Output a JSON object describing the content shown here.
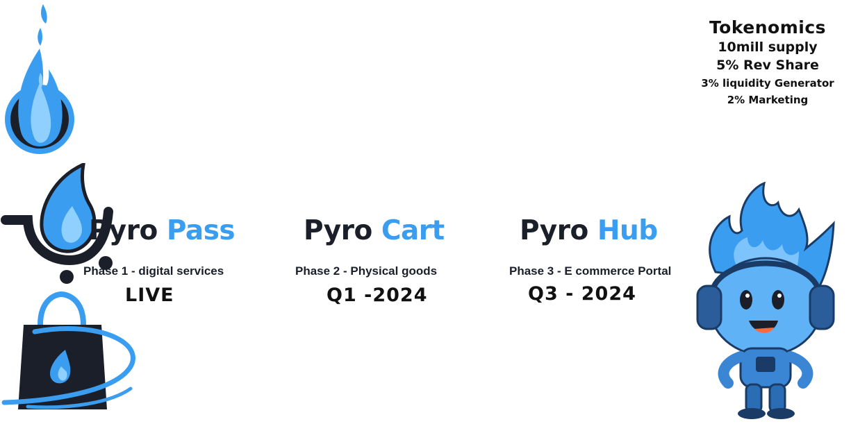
{
  "products": [
    {
      "name_word1": "Pyro",
      "name_word2": "Pass",
      "phase": "Phase 1 - digital services",
      "status": "LIVE",
      "icon": "flame-circle-icon"
    },
    {
      "name_word1": "Pyro",
      "name_word2": "Cart",
      "phase": "Phase 2 - Physical goods",
      "status": "Q1 -2024",
      "icon": "cart-flame-icon"
    },
    {
      "name_word1": "Pyro",
      "name_word2": "Hub",
      "phase": "Phase 3 - E commerce Portal",
      "status": "Q3 - 2024",
      "icon": "shopping-bag-flame-icon"
    }
  ],
  "tokenomics": {
    "title": "Tokenomics",
    "lines": [
      "10mill supply",
      "5% Rev Share",
      "3% liquidity Generator",
      "2% Marketing"
    ]
  },
  "colors": {
    "brand_blue": "#3a9df0",
    "dark": "#1a1f29"
  },
  "mascot": "flame-mascot-with-headphones"
}
